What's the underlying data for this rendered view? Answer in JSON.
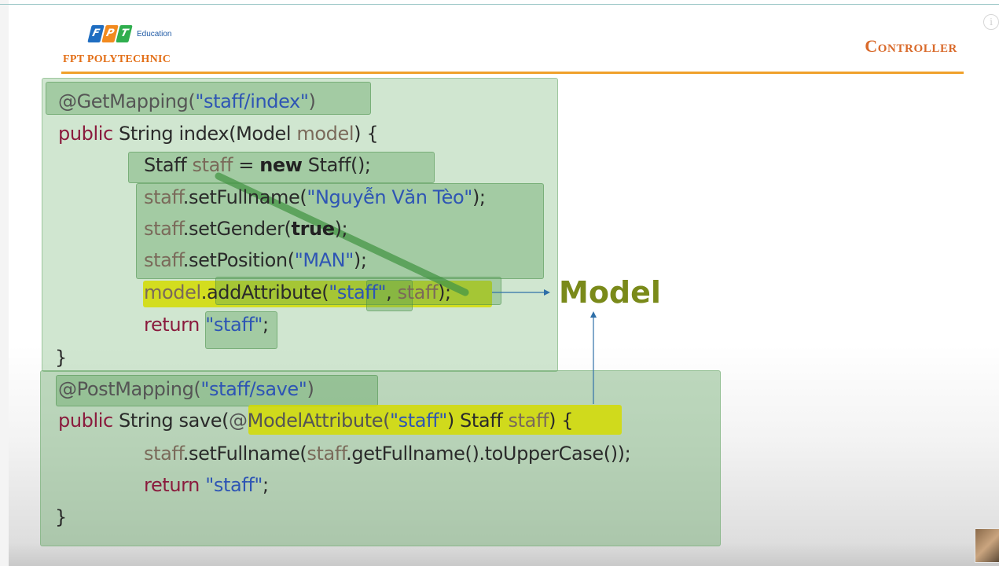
{
  "logo": {
    "tiles": [
      "F",
      "P",
      "T"
    ],
    "education": "Education",
    "brand": "FPT POLYTECHNIC"
  },
  "slide": {
    "title": "Controller",
    "model_label": "Model"
  },
  "code1": {
    "l1_ann": "@GetMapping(",
    "l1_str": "\"staff/index\"",
    "l1_end": ")",
    "l2_kw": "public",
    "l2_a": " String index(Model ",
    "l2_var": "model",
    "l2_b": ") {",
    "l3_a": "Staff ",
    "l3_var": "staff",
    "l3_b": " = ",
    "l3_new": "new",
    "l3_c": " Staff();",
    "l4_var": "staff",
    "l4_a": ".setFullname(",
    "l4_str": "\"Nguyễn Văn Tèo\"",
    "l4_b": ");",
    "l5_var": "staff",
    "l5_a": ".setGender(",
    "l5_kw": "true",
    "l5_b": ");",
    "l6_var": "staff",
    "l6_a": ".setPosition(",
    "l6_str": "\"MAN\"",
    "l6_b": ");",
    "l7_var": "model",
    "l7_a": ".addAttribute(",
    "l7_str": "\"staff\"",
    "l7_b": ", ",
    "l7_var2": "staff",
    "l7_c": ");",
    "l8_kw": "return",
    "l8_a": " ",
    "l8_str": "\"staff\"",
    "l8_b": ";",
    "l9": "}"
  },
  "code2": {
    "l1_ann": "@PostMapping(",
    "l1_str": "\"staff/save\"",
    "l1_end": ")",
    "l2_kw": "public",
    "l2_a": " String save(",
    "l2_ann": "@ModelAttribute(",
    "l2_str": "\"staff\"",
    "l2_b": ") Staff ",
    "l2_var": "staff",
    "l2_c": ") {",
    "l3_var": "staff",
    "l3_a": ".setFullname(",
    "l3_var2": "staff",
    "l3_b": ".getFullname().toUpperCase());",
    "l4_kw": "return",
    "l4_a": " ",
    "l4_str": "\"staff\"",
    "l4_b": ";",
    "l5": "}"
  },
  "colors": {
    "brand_orange": "#e36f17",
    "rule_orange": "#f0a12b",
    "keyword": "#8a1b3d",
    "string": "#2e55b4",
    "highlight_yellow": "#d4da00",
    "panel_green": "#7cb97c",
    "model_text": "#7a8a1a",
    "arrow": "#2f6fa8"
  }
}
